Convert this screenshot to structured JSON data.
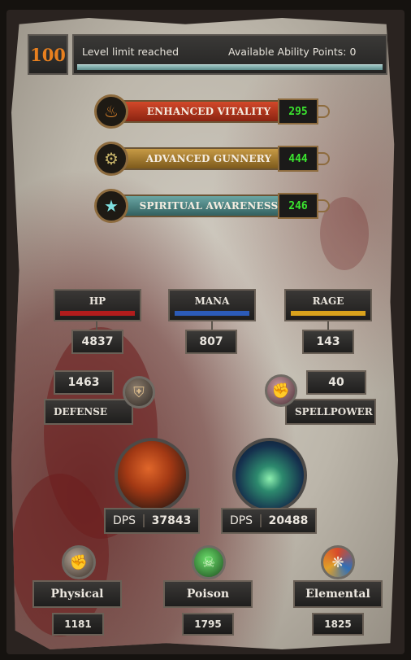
{
  "header": {
    "level": "100",
    "status": "Level limit reached",
    "ability_points_text": "Available Ability Points: 0"
  },
  "abilities": [
    {
      "name": "ENHANCED VITALITY",
      "value": "295",
      "icon": "flame-emblem-icon",
      "color": "#b3341d"
    },
    {
      "name": "ADVANCED GUNNERY",
      "value": "444",
      "icon": "dragon-emblem-icon",
      "color": "#a8802e"
    },
    {
      "name": "SPIRITUAL AWARENESS",
      "value": "246",
      "icon": "pentagram-icon",
      "color": "#4f8a8a"
    }
  ],
  "resources": [
    {
      "label": "HP",
      "value": "4837",
      "color": "#b21c1c"
    },
    {
      "label": "MANA",
      "value": "807",
      "color": "#2c5bb8"
    },
    {
      "label": "RAGE",
      "value": "143",
      "color": "#d9a21c"
    }
  ],
  "defense": {
    "label": "DEFENSE",
    "value": "1463",
    "icon": "shield-icon"
  },
  "spellpower": {
    "label": "SPELLPOWER",
    "value": "40",
    "icon": "fist-icon"
  },
  "dps": [
    {
      "label": "DPS",
      "value": "37843",
      "icon": "melee-gear-orb-icon"
    },
    {
      "label": "DPS",
      "value": "20488",
      "icon": "magic-claw-orb-icon"
    }
  ],
  "damage_types": [
    {
      "label": "Physical",
      "value": "1181",
      "icon": "physical-fist-icon"
    },
    {
      "label": "Poison",
      "value": "1795",
      "icon": "skull-icon"
    },
    {
      "label": "Elemental",
      "value": "1825",
      "icon": "elemental-swirl-icon"
    }
  ]
}
